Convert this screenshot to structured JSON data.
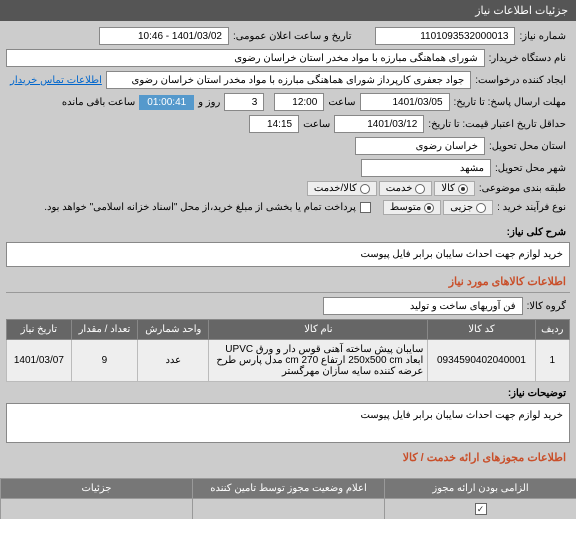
{
  "header": {
    "title": "جزئیات اطلاعات نیاز"
  },
  "fields": {
    "need_no_label": "شماره نیاز:",
    "need_no": "1101093532000013",
    "public_date_label": "تاریخ و ساعت اعلان عمومی:",
    "public_date": "1401/03/02 - 10:46",
    "buyer_label": "نام دستگاه خریدار:",
    "buyer": "شورای هماهنگی مبارزه با مواد مخدر استان خراسان رضوی",
    "requester_label": "ایجاد کننده درخواست:",
    "requester": "جواد جعفری کارپرداز شورای هماهنگی مبارزه با مواد مخدر استان خراسان رضوی",
    "contact_link": "اطلاعات تماس خریدار",
    "deadline_label": "مهلت ارسال پاسخ: تا تاریخ:",
    "deadline_date": "1401/03/05",
    "deadline_time_label": "ساعت",
    "deadline_time": "12:00",
    "days_label": "روز و",
    "days": "3",
    "remain_label": "ساعت باقی مانده",
    "remain": "01:00:41",
    "valid_label": "حداقل تاریخ اعتبار قیمت: تا تاریخ:",
    "valid_date": "1401/03/12",
    "valid_time_label": "ساعت",
    "valid_time": "14:15",
    "province_label": "استان محل تحویل:",
    "province": "خراسان رضوی",
    "city_label": "شهر محل تحویل:",
    "city": "مشهد",
    "class_label": "طبقه بندی موضوعی:",
    "class_opts": [
      "کالا",
      "خدمت",
      "کالا/خدمت"
    ],
    "process_label": "نوع فرآیند خرید :",
    "process_opts": [
      "جزیی",
      "متوسط"
    ],
    "process_note": "پرداخت تمام یا بخشی از مبلغ خرید،از محل \"اسناد خزانه اسلامی\" خواهد بود.",
    "desc_label": "شرح کلی نیاز:",
    "desc": "خرید لوازم جهت  احداث سایبان برابر فایل پیوست",
    "goods_header": "اطلاعات کالاهای مورد نیاز",
    "group_label": "گروه کالا:",
    "group": "فن آوریهای ساخت و تولید",
    "extra_desc_label": "توضیحات نیاز:",
    "extra_desc": "خرید لوازم جهت  احداث سایبان برابر فایل پیوست",
    "permits_header": "اطلاعات مجوزهای ارائه خدمت / کالا"
  },
  "table": {
    "headers": [
      "ردیف",
      "کد کالا",
      "نام کالا",
      "واحد شمارش",
      "تعداد / مقدار",
      "تاریخ نیاز"
    ],
    "rows": [
      {
        "idx": "1",
        "code": "0934590402040001",
        "name": "سایبان پیش ساخته آهنی قوس دار و ورق UPVC ابعاد 250x500 cm ارتفاع 270 cm مدل پارس طرح عرضه کننده سایه سازان مهرگستر",
        "unit": "عدد",
        "qty": "9",
        "date": "1401/03/07"
      }
    ]
  },
  "footer": {
    "col1": "الزامی بودن ارائه مجوز",
    "col2": "اعلام وضعیت مجوز توسط تامین کننده",
    "col3": "جزئیات"
  }
}
